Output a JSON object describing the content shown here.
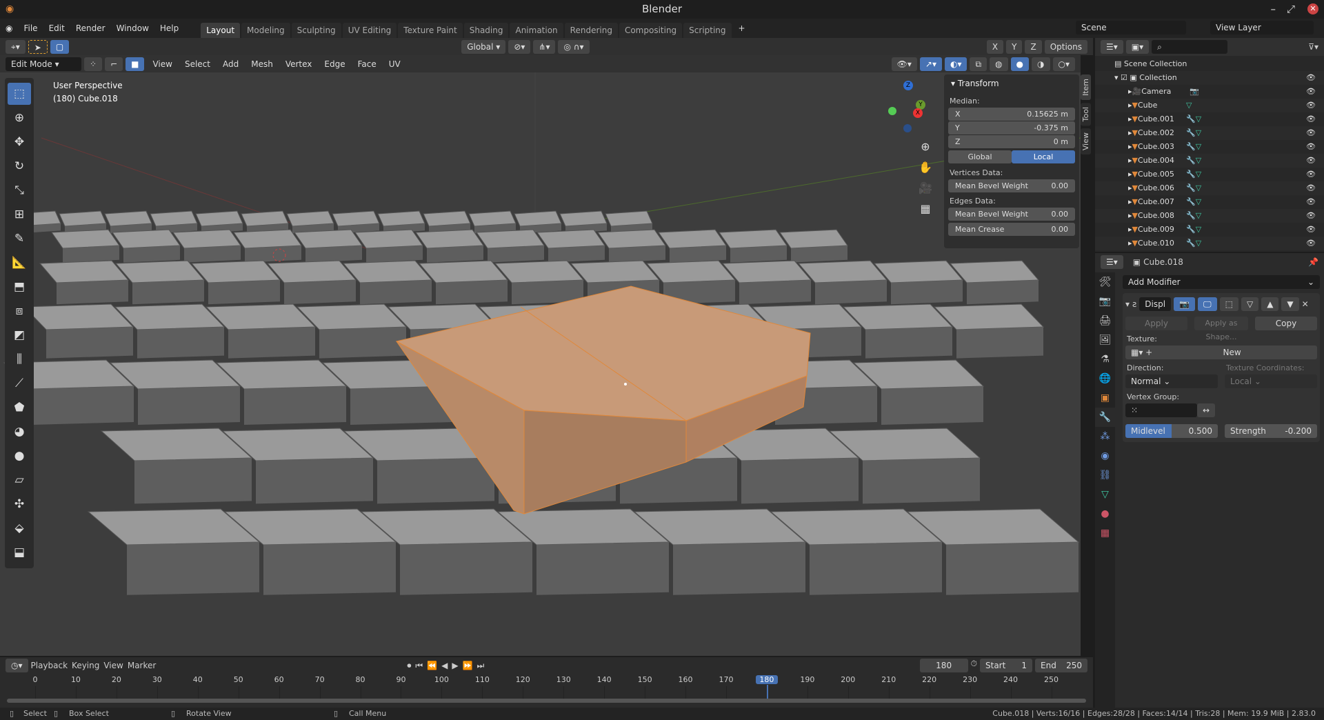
{
  "app": {
    "title": "Blender"
  },
  "menu": [
    "File",
    "Edit",
    "Render",
    "Window",
    "Help"
  ],
  "workspaces": [
    "Layout",
    "Modeling",
    "Sculpting",
    "UV Editing",
    "Texture Paint",
    "Shading",
    "Animation",
    "Rendering",
    "Compositing",
    "Scripting"
  ],
  "active_workspace": "Layout",
  "scene": {
    "scene_name": "Scene",
    "view_layer": "View Layer"
  },
  "tool_header": {
    "orientation": "Global",
    "options": "Options",
    "axes": [
      "X",
      "Y",
      "Z"
    ]
  },
  "viewport_header": {
    "mode": "Edit Mode",
    "menus": [
      "View",
      "Select",
      "Add",
      "Mesh",
      "Vertex",
      "Edge",
      "Face",
      "UV"
    ]
  },
  "viewport": {
    "perspective": "User Perspective",
    "object": "(180) Cube.018",
    "gizmo": {
      "x": "X",
      "y": "Y",
      "z": "Z"
    }
  },
  "npanel": {
    "title": "Transform",
    "median_label": "Median:",
    "x": {
      "label": "X",
      "value": "0.15625 m"
    },
    "y": {
      "label": "Y",
      "value": "-0.375 m"
    },
    "z": {
      "label": "Z",
      "value": "0 m"
    },
    "global": "Global",
    "local": "Local",
    "vertices_label": "Vertices Data:",
    "v_bevel": {
      "label": "Mean Bevel Weight",
      "value": "0.00"
    },
    "edges_label": "Edges Data:",
    "e_bevel": {
      "label": "Mean Bevel Weight",
      "value": "0.00"
    },
    "crease": {
      "label": "Mean Crease",
      "value": "0.00"
    },
    "tabs": [
      "Item",
      "Tool",
      "View"
    ]
  },
  "outliner": {
    "root": "Scene Collection",
    "collection": "Collection",
    "items": [
      "Camera",
      "Cube",
      "Cube.001",
      "Cube.002",
      "Cube.003",
      "Cube.004",
      "Cube.005",
      "Cube.006",
      "Cube.007",
      "Cube.008",
      "Cube.009",
      "Cube.010"
    ]
  },
  "properties": {
    "object": "Cube.018",
    "add_modifier": "Add Modifier",
    "modifier_name": "Displ",
    "apply": "Apply",
    "apply_shape": "Apply as Shape...",
    "copy": "Copy",
    "texture_label": "Texture:",
    "new": "New",
    "direction_label": "Direction:",
    "direction": "Normal",
    "texcoords_label": "Texture Coordinates:",
    "texcoords": "Local",
    "vgroup_label": "Vertex Group:",
    "midlevel": {
      "label": "Midlevel",
      "value": "0.500"
    },
    "strength": {
      "label": "Strength",
      "value": "-0.200"
    }
  },
  "timeline": {
    "menus": [
      "Playback",
      "Keying",
      "View",
      "Marker"
    ],
    "current_frame": "180",
    "start_label": "Start",
    "start": "1",
    "end_label": "End",
    "end": "250",
    "ticks": [
      "0",
      "10",
      "20",
      "30",
      "40",
      "50",
      "60",
      "70",
      "80",
      "90",
      "100",
      "110",
      "120",
      "130",
      "140",
      "150",
      "160",
      "170",
      "180",
      "190",
      "200",
      "210",
      "220",
      "230",
      "240",
      "250"
    ]
  },
  "status": {
    "select": "Select",
    "box_select": "Box Select",
    "rotate": "Rotate View",
    "call_menu": "Call Menu",
    "stats": "Cube.018 | Verts:16/16 | Edges:28/28 | Faces:14/14 | Tris:28 | Mem: 19.9 MiB | 2.83.0"
  },
  "colors": {
    "accent": "#4772b3",
    "selection": "#e0883a",
    "mesh_data": "#3fc6a1"
  }
}
